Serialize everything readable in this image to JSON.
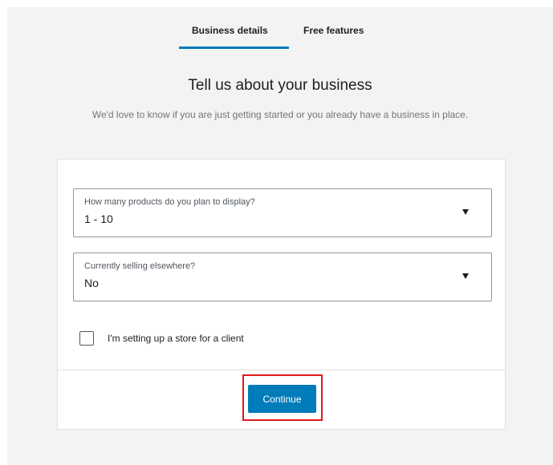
{
  "tabs": [
    {
      "label": "Business details",
      "active": true
    },
    {
      "label": "Free features",
      "active": false
    }
  ],
  "header": {
    "title": "Tell us about your business",
    "subtitle": "We'd love to know if you are just getting started or you already have a business in place."
  },
  "form": {
    "products": {
      "label": "How many products do you plan to display?",
      "value": "1 - 10"
    },
    "selling": {
      "label": "Currently selling elsewhere?",
      "value": "No"
    },
    "client_checkbox": {
      "label": "I'm setting up a store for a client",
      "checked": false
    },
    "continue_label": "Continue"
  },
  "icons": {
    "dropdown": "caret-down-icon"
  },
  "colors": {
    "accent": "#007cba",
    "highlight": "#e0191c",
    "page_background": "#f3f3f3"
  }
}
